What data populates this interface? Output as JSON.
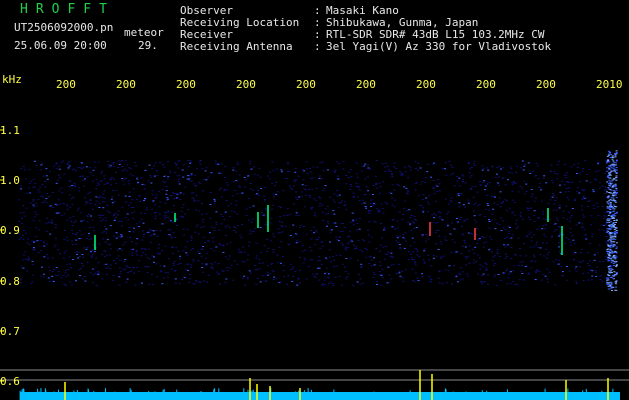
{
  "header": {
    "logo": "HROFFT",
    "filename": "UT2506092000.pn",
    "type_label": "meteor",
    "datetime": "25.06.09 20:00",
    "count": "29."
  },
  "info": {
    "labels": [
      "Observer",
      "Receiving Location",
      "Receiver",
      "Receiving Antenna"
    ],
    "sep": ":",
    "values": [
      "Masaki Kano",
      "Shibukawa, Gunma, Japan",
      "RTL-SDR SDR# 43dB L15 103.2MHz CW",
      "3el Yagi(V) Az 330 for Vladivostok"
    ]
  },
  "axis": {
    "unit": "kHz",
    "y_ticks": [
      "1.1",
      "1.0",
      "0.9",
      "0.8",
      "0.7",
      "0.6"
    ],
    "x_ticks": [
      "200",
      "200",
      "200",
      "200",
      "200",
      "200",
      "200",
      "200",
      "200",
      "2010"
    ]
  },
  "colors": {
    "background": "#000000",
    "noise_low": "#101070",
    "noise_high": "#3a5cff",
    "echo": "#00ff80",
    "echo_hot": "#ff4040",
    "band_base": "#00bfff",
    "spike": "#ffff00"
  }
}
